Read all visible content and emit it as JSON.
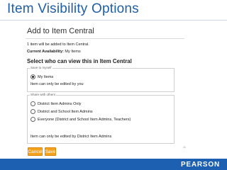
{
  "slide": {
    "title": "Item Visibility Options",
    "page_number": "11",
    "footer_logo": "PEARSON"
  },
  "dialog": {
    "title": "Add to Item Central",
    "count_line": "1 item will be added to Item Central.",
    "availability_label": "Current Availability:",
    "availability_value": "My Items",
    "heading": "Select who can view this in Item Central",
    "save_to_myself": {
      "legend": "Save to myself",
      "option": "My Items",
      "selected": true,
      "note": "Item can only be edited by you"
    },
    "share_with_others": {
      "legend": "Share with others",
      "options": [
        "District Item Admins Only",
        "District and School Item Admins",
        "Everyone (District and School Item Admins, Teachers)"
      ],
      "note": "Item can only be edited by District Item Admins"
    },
    "buttons": {
      "cancel": "Cancel",
      "save": "Save"
    }
  },
  "colors": {
    "title": "#1f5fa8",
    "footer": "#1d5fb0",
    "button": "#f4a11b"
  }
}
